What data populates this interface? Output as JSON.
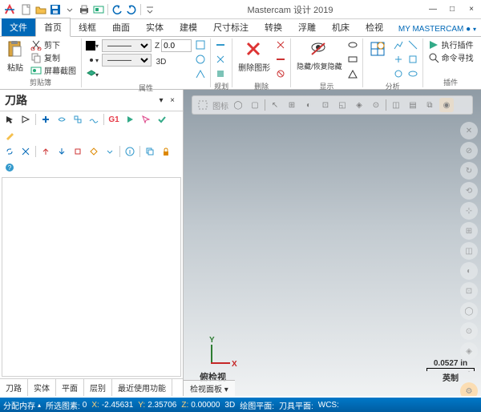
{
  "title": "Mastercam 设计 2019",
  "win_controls": {
    "min": "—",
    "max": "□",
    "close": "×"
  },
  "qat": [
    "new-file",
    "open-file",
    "save",
    "separator",
    "print",
    "screenshot",
    "separator",
    "undo",
    "redo",
    "separator",
    "dropdown"
  ],
  "tabs": {
    "file": "文件",
    "items": [
      "首页",
      "线框",
      "曲面",
      "实体",
      "建模",
      "尺寸标注",
      "转换",
      "浮雕",
      "机床",
      "检视"
    ],
    "right": "MY MASTERCAM",
    "right_icon": "●"
  },
  "ribbon": {
    "clipboard": {
      "paste": "粘贴",
      "cut": "剪下",
      "copy": "复制",
      "screenshot": "屏幕截图",
      "label": "剪贴簿"
    },
    "properties": {
      "z_label": "Z",
      "z_value": "0.0",
      "mode": "3D",
      "label": "属性"
    },
    "plan": {
      "label": "规划"
    },
    "delete": {
      "main": "删除图形",
      "label": "删除"
    },
    "display": {
      "main": "隐藏/恢复隐藏",
      "label": "显示"
    },
    "analyze": {
      "label": "分析"
    },
    "plugins": {
      "run": "执行插件",
      "find": "命令寻找",
      "label": "插件"
    }
  },
  "left_panel": {
    "title": "刀路",
    "bottom_tabs": [
      "刀路",
      "实体",
      "平面",
      "层别",
      "最近使用功能"
    ]
  },
  "viewport": {
    "axis_x": "X",
    "axis_y": "Y",
    "scale_val": "0.0527 in",
    "scale_unit": "英制",
    "view_label": "俯检视",
    "bottom_tab": "检视面板 ▾"
  },
  "status": {
    "mem_lbl": "分配内存",
    "sel_lbl": "所选图素:",
    "sel_val": "0",
    "x_lbl": "X:",
    "x_val": "-2.45631",
    "y_lbl": "Y:",
    "y_val": "2.35706",
    "z_lbl": "Z:",
    "z_val": "0.00000",
    "mode": "3D",
    "plane_lbl": "绘图平面:",
    "tool_lbl": "刀具平面:",
    "wcs_lbl": "WCS:"
  }
}
